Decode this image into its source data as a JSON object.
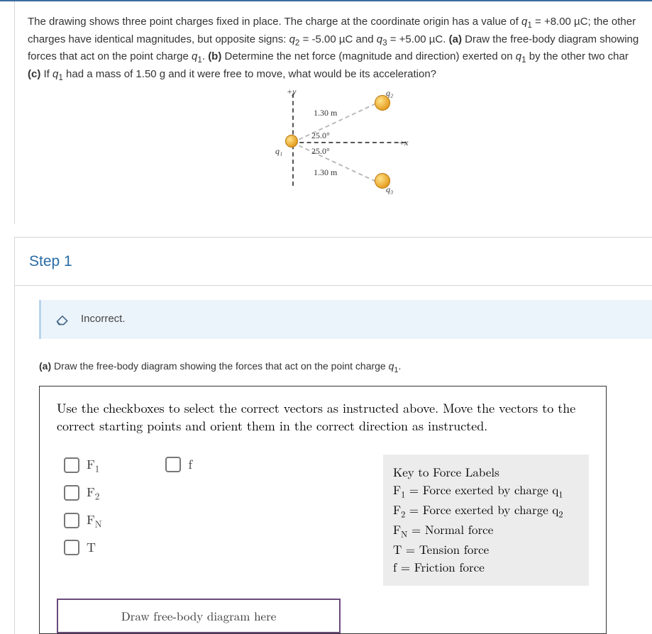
{
  "question": {
    "line1_a": "The drawing shows three point charges fixed in place. The charge at the coordinate origin has a value of ",
    "q1_sym": "q",
    "q1_sub": "1",
    "q1_eq": " = +8.00 µC; the other",
    "line2_a": "charges have identical magnitudes, but opposite signs: ",
    "q2_sym": "q",
    "q2_sub": "2",
    "q2_eq": " = -5.00 µC and ",
    "q3_sym": "q",
    "q3_sub": "3",
    "q3_eq": " = +5.00 µC. ",
    "part_a_label": "(a)",
    "part_a_text": " Draw the free-body diagram showing",
    "line3_a": "forces that act on the point charge ",
    "line3_q1": "q",
    "line3_q1sub": "1",
    "line3_b": ". ",
    "part_b_label": "(b)",
    "part_b_text": " Determine the net force (magnitude and direction) exerted on ",
    "line3_q1b": "q",
    "line3_q1bsub": "1",
    "line3_c": " by the other two char",
    "part_c_label": "(c)",
    "part_c_text": " If ",
    "line4_q1": "q",
    "line4_q1sub": "1",
    "line4_rest": " had a mass of 1.50 g and it were free to move, what would be its acceleration?"
  },
  "diagram": {
    "plus_y": "+y",
    "plus_x": "+x",
    "q1": "q₁",
    "q2": "q₂",
    "q3": "q₃",
    "dist": "1.30 m",
    "angle": "25.0°"
  },
  "step": {
    "title": "Step 1",
    "alert": "Incorrect.",
    "part_a_full_a": "(a) ",
    "part_a_full_b": "Draw the free-body diagram showing the forces that act on the point charge ",
    "part_a_full_q": "q",
    "part_a_full_sub": "1",
    "part_a_full_end": "."
  },
  "fbd": {
    "instructions": "Use the checkboxes to select the correct vectors as instructed above. Move the vectors to the correct starting points and orient them in the correct direction as instructed.",
    "checks_col1": [
      {
        "label": "F",
        "sub": "1"
      },
      {
        "label": "F",
        "sub": "2"
      },
      {
        "label": "F",
        "sub": "N"
      },
      {
        "label": "T",
        "sub": ""
      }
    ],
    "checks_col2": [
      {
        "label": "f",
        "sub": ""
      }
    ],
    "key_title": "Key to Force Labels",
    "key_items": [
      {
        "sym": "F",
        "sub": "1",
        "desc": "Force exerted by charge q",
        "dsub": "1"
      },
      {
        "sym": "F",
        "sub": "2",
        "desc": "Force exerted by charge q",
        "dsub": "2"
      },
      {
        "sym": "F",
        "sub": "N",
        "desc": "Normal force",
        "dsub": ""
      },
      {
        "sym": "T",
        "sub": "",
        "desc": "Tension force",
        "dsub": ""
      },
      {
        "sym": "f",
        "sub": "",
        "desc": "Friction force",
        "dsub": ""
      }
    ],
    "draw_label": "Draw free-body diagram here"
  }
}
